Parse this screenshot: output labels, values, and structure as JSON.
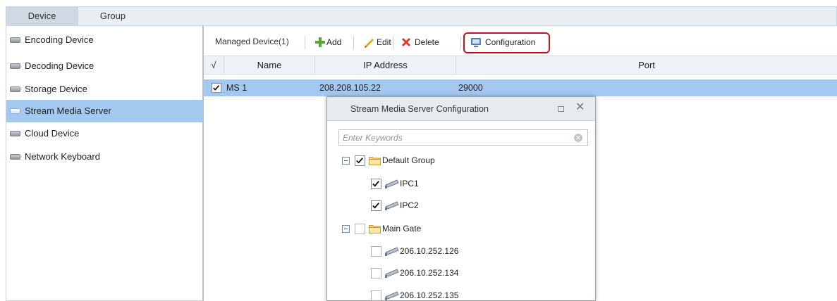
{
  "top_tabs": {
    "device": "Device",
    "group": "Group"
  },
  "sidebar": {
    "items": [
      {
        "label": "Encoding Device",
        "active": false
      },
      {
        "label": "Decoding Device",
        "active": false
      },
      {
        "label": "Storage Device",
        "active": false
      },
      {
        "label": "Stream Media Server",
        "active": true
      },
      {
        "label": "Cloud Device",
        "active": false
      },
      {
        "label": "Network Keyboard",
        "active": false
      }
    ]
  },
  "toolbar": {
    "managed_label": "Managed Device(1)",
    "add_label": "Add",
    "edit_label": "Edit",
    "delete_label": "Delete",
    "configuration_label": "Configuration",
    "highlight_color": "#c4161c"
  },
  "table": {
    "headers": {
      "check": "√",
      "name": "Name",
      "ip": "IP Address",
      "port": "Port"
    },
    "rows": [
      {
        "checked": true,
        "name": "MS 1",
        "ip": "208.208.105.22",
        "port": "29000"
      }
    ]
  },
  "dialog": {
    "title": "Stream Media Server Configuration",
    "search_placeholder": "Enter Keywords",
    "tree": {
      "groups": [
        {
          "name": "Default Group",
          "checked": true,
          "children": [
            {
              "name": "IPC1",
              "checked": true
            },
            {
              "name": "IPC2",
              "checked": true
            }
          ]
        },
        {
          "name": "Main Gate",
          "checked": false,
          "children": [
            {
              "name": "206.10.252.126",
              "checked": false
            },
            {
              "name": "206.10.252.134",
              "checked": false
            },
            {
              "name": "206.10.252.135",
              "checked": false
            }
          ]
        }
      ]
    }
  },
  "colors": {
    "selection": "#a4c9f1",
    "header_bg": "#e9eef3"
  }
}
